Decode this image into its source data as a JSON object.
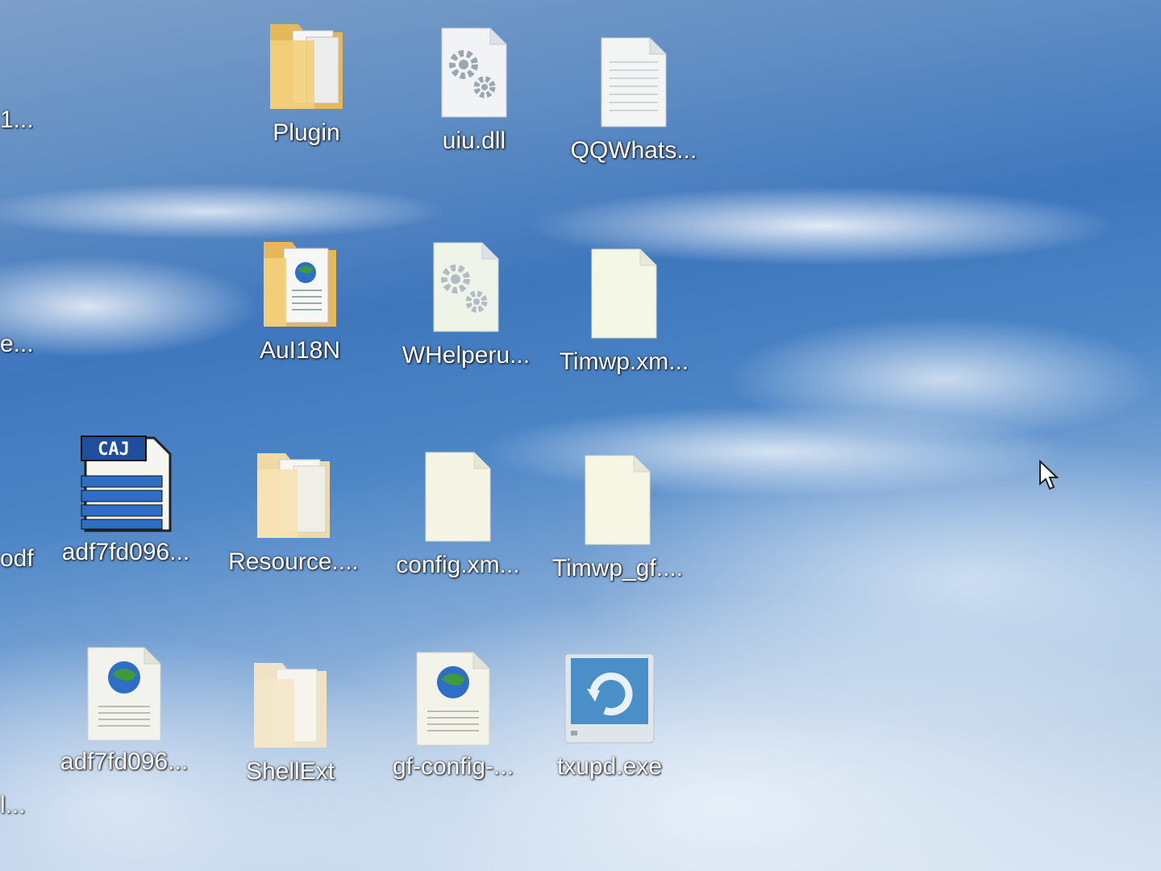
{
  "desktop": {
    "partial_labels": [
      "1...",
      "e...",
      "odf",
      "l..."
    ],
    "icons": [
      {
        "label": "Plugin",
        "icon": "folder-icon"
      },
      {
        "label": "uiu.dll",
        "icon": "dll-gear-file-icon"
      },
      {
        "label": "QQWhats...",
        "icon": "text-document-icon"
      },
      {
        "label": "AuI18N",
        "icon": "folder-html-icon"
      },
      {
        "label": "WHelperu...",
        "icon": "dll-gear-file-icon"
      },
      {
        "label": "Timwp.xm...",
        "icon": "blank-file-icon"
      },
      {
        "label": "adf7fd096...",
        "icon": "caj-document-icon"
      },
      {
        "label": "Resource....",
        "icon": "folder-icon"
      },
      {
        "label": "config.xm...",
        "icon": "blank-file-icon"
      },
      {
        "label": "Timwp_gf....",
        "icon": "blank-file-icon"
      },
      {
        "label": "adf7fd096...",
        "icon": "html-document-icon"
      },
      {
        "label": "ShellExt",
        "icon": "folder-icon"
      },
      {
        "label": "gf-config-...",
        "icon": "html-document-icon"
      },
      {
        "label": "txupd.exe",
        "icon": "updater-exe-icon"
      }
    ]
  },
  "colors": {
    "folder": "#f3cf7a",
    "file": "#f4f4ec",
    "gear": "#9aa6b0",
    "caj_blue": "#1f4e9e"
  }
}
